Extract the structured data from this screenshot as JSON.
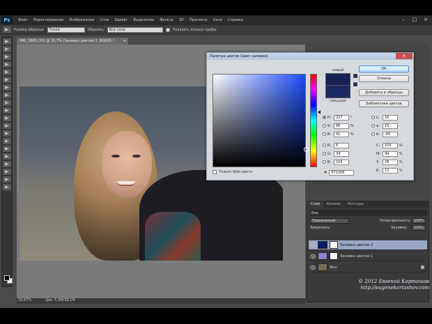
{
  "menubar": {
    "logo": "Ps",
    "items": [
      "Файл",
      "Редактирование",
      "Изображение",
      "Слои",
      "Шрифт",
      "Выделение",
      "Фильтр",
      "3D",
      "Просмотр",
      "Окно",
      "Справка"
    ]
  },
  "optbar": {
    "sample_size_label": "Размер образца:",
    "sample_size_value": "Точка",
    "sample_label": "Образец:",
    "sample_value": "Все слои",
    "show_ring_label": "Показать кольцо пробы"
  },
  "document": {
    "tab_title": "IMG_5865.CR2 @ 16,7% (Заливка цветом 2, RGB/8) *",
    "close_glyph": "×",
    "zoom": "16,67%",
    "doc_size": "Док: 5,3M/38,1M"
  },
  "color_picker": {
    "title": "Палитра цветов (Цвет заливки)",
    "close_glyph": "×",
    "new_label": "новый",
    "current_label": "текущий",
    "buttons": {
      "ok": "ОК",
      "cancel": "Отмена",
      "add_swatch": "Добавить в образцы",
      "libraries": "Библиотеки цветов"
    },
    "web_only_label": "Только Web-цвета",
    "hsb": [
      {
        "label": "H:",
        "value": "227",
        "unit": "°"
      },
      {
        "label": "S:",
        "value": "86",
        "unit": "%"
      },
      {
        "label": "B:",
        "value": "41",
        "unit": "%"
      }
    ],
    "rgb": [
      {
        "label": "R:",
        "value": "6",
        "unit": ""
      },
      {
        "label": "G:",
        "value": "34",
        "unit": ""
      },
      {
        "label": "B:",
        "value": "104",
        "unit": ""
      }
    ],
    "lab": [
      {
        "label": "L:",
        "value": "16",
        "unit": ""
      },
      {
        "label": "a:",
        "value": "15",
        "unit": ""
      },
      {
        "label": "b:",
        "value": "-45",
        "unit": ""
      }
    ],
    "cmyk": [
      {
        "label": "C:",
        "value": "100",
        "unit": "%"
      },
      {
        "label": "M:",
        "value": "94",
        "unit": "%"
      },
      {
        "label": "Y:",
        "value": "28",
        "unit": "%"
      },
      {
        "label": "K:",
        "value": "13",
        "unit": "%"
      }
    ],
    "hex_label": "#",
    "hex_value": "072268",
    "new_color": "#162259",
    "current_color": "#1a2a62"
  },
  "layers_panel": {
    "tabs": [
      "Слои",
      "Каналы",
      "Контуры"
    ],
    "kind_label": "Вид",
    "blend_mode": "Нормальный",
    "opacity_label": "Непрозрачность:",
    "opacity_value": "100%",
    "lock_label": "Закрепить:",
    "fill_label": "Заливка:",
    "fill_value": "100%",
    "layers": [
      {
        "name": "Заливка цветом 2",
        "thumb": "#0a1a6a",
        "selected": true
      },
      {
        "name": "Заливка цветом 1",
        "thumb": "#8a80d8",
        "selected": false
      },
      {
        "name": "Фон",
        "thumb": "#7a6a55",
        "selected": false
      }
    ]
  },
  "watermark": {
    "line1": "© 2012 Евгений Карташов",
    "line2": "http://eugenekartashov.com"
  }
}
